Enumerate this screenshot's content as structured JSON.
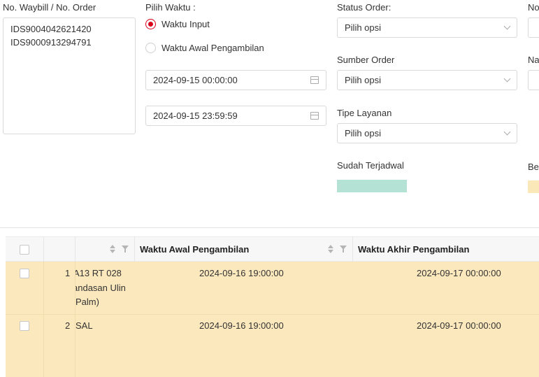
{
  "filters": {
    "waybill_label": "No. Waybill / No. Order",
    "waybill_values": [
      "IDS9004042621420",
      "IDS9000913294791"
    ],
    "pilih_waktu_label": "Pilih Waktu :",
    "radio_input_label": "Waktu Input",
    "radio_awal_label": "Waktu Awal Pengambilan",
    "date_start": "2024-09-15 00:00:00",
    "date_end": "2024-09-15 23:59:59",
    "status_order_label": "Status Order:",
    "status_order_value": "Pilih opsi",
    "sumber_order_label": "Sumber Order",
    "sumber_order_value": "Pilih opsi",
    "tipe_layanan_label": "Tipe Layanan",
    "tipe_layanan_value": "Pilih opsi",
    "sudah_terjadwal_label": "Sudah Terjadwal",
    "right_label_1": "No",
    "right_label_2": "Na",
    "right_label_3": "Be"
  },
  "colors": {
    "accent_red": "#d9001b",
    "scheduled_green": "#b4e2d4",
    "row_highlight": "#fbe8bd"
  },
  "table": {
    "columns": [
      "Waktu Awal Pengambilan",
      "Waktu Akhir Pengambilan"
    ],
    "rows": [
      {
        "no": "1",
        "address_lines": [
          "A13 RT 028",
          "andasan Ulin",
          "Palm)"
        ],
        "waktu_awal": "2024-09-16 19:00:00",
        "waktu_akhir": "2024-09-17 00:00:00"
      },
      {
        "no": "2",
        "address_lines": [
          "SAL"
        ],
        "waktu_awal": "2024-09-16 19:00:00",
        "waktu_akhir": "2024-09-17 00:00:00"
      }
    ]
  }
}
